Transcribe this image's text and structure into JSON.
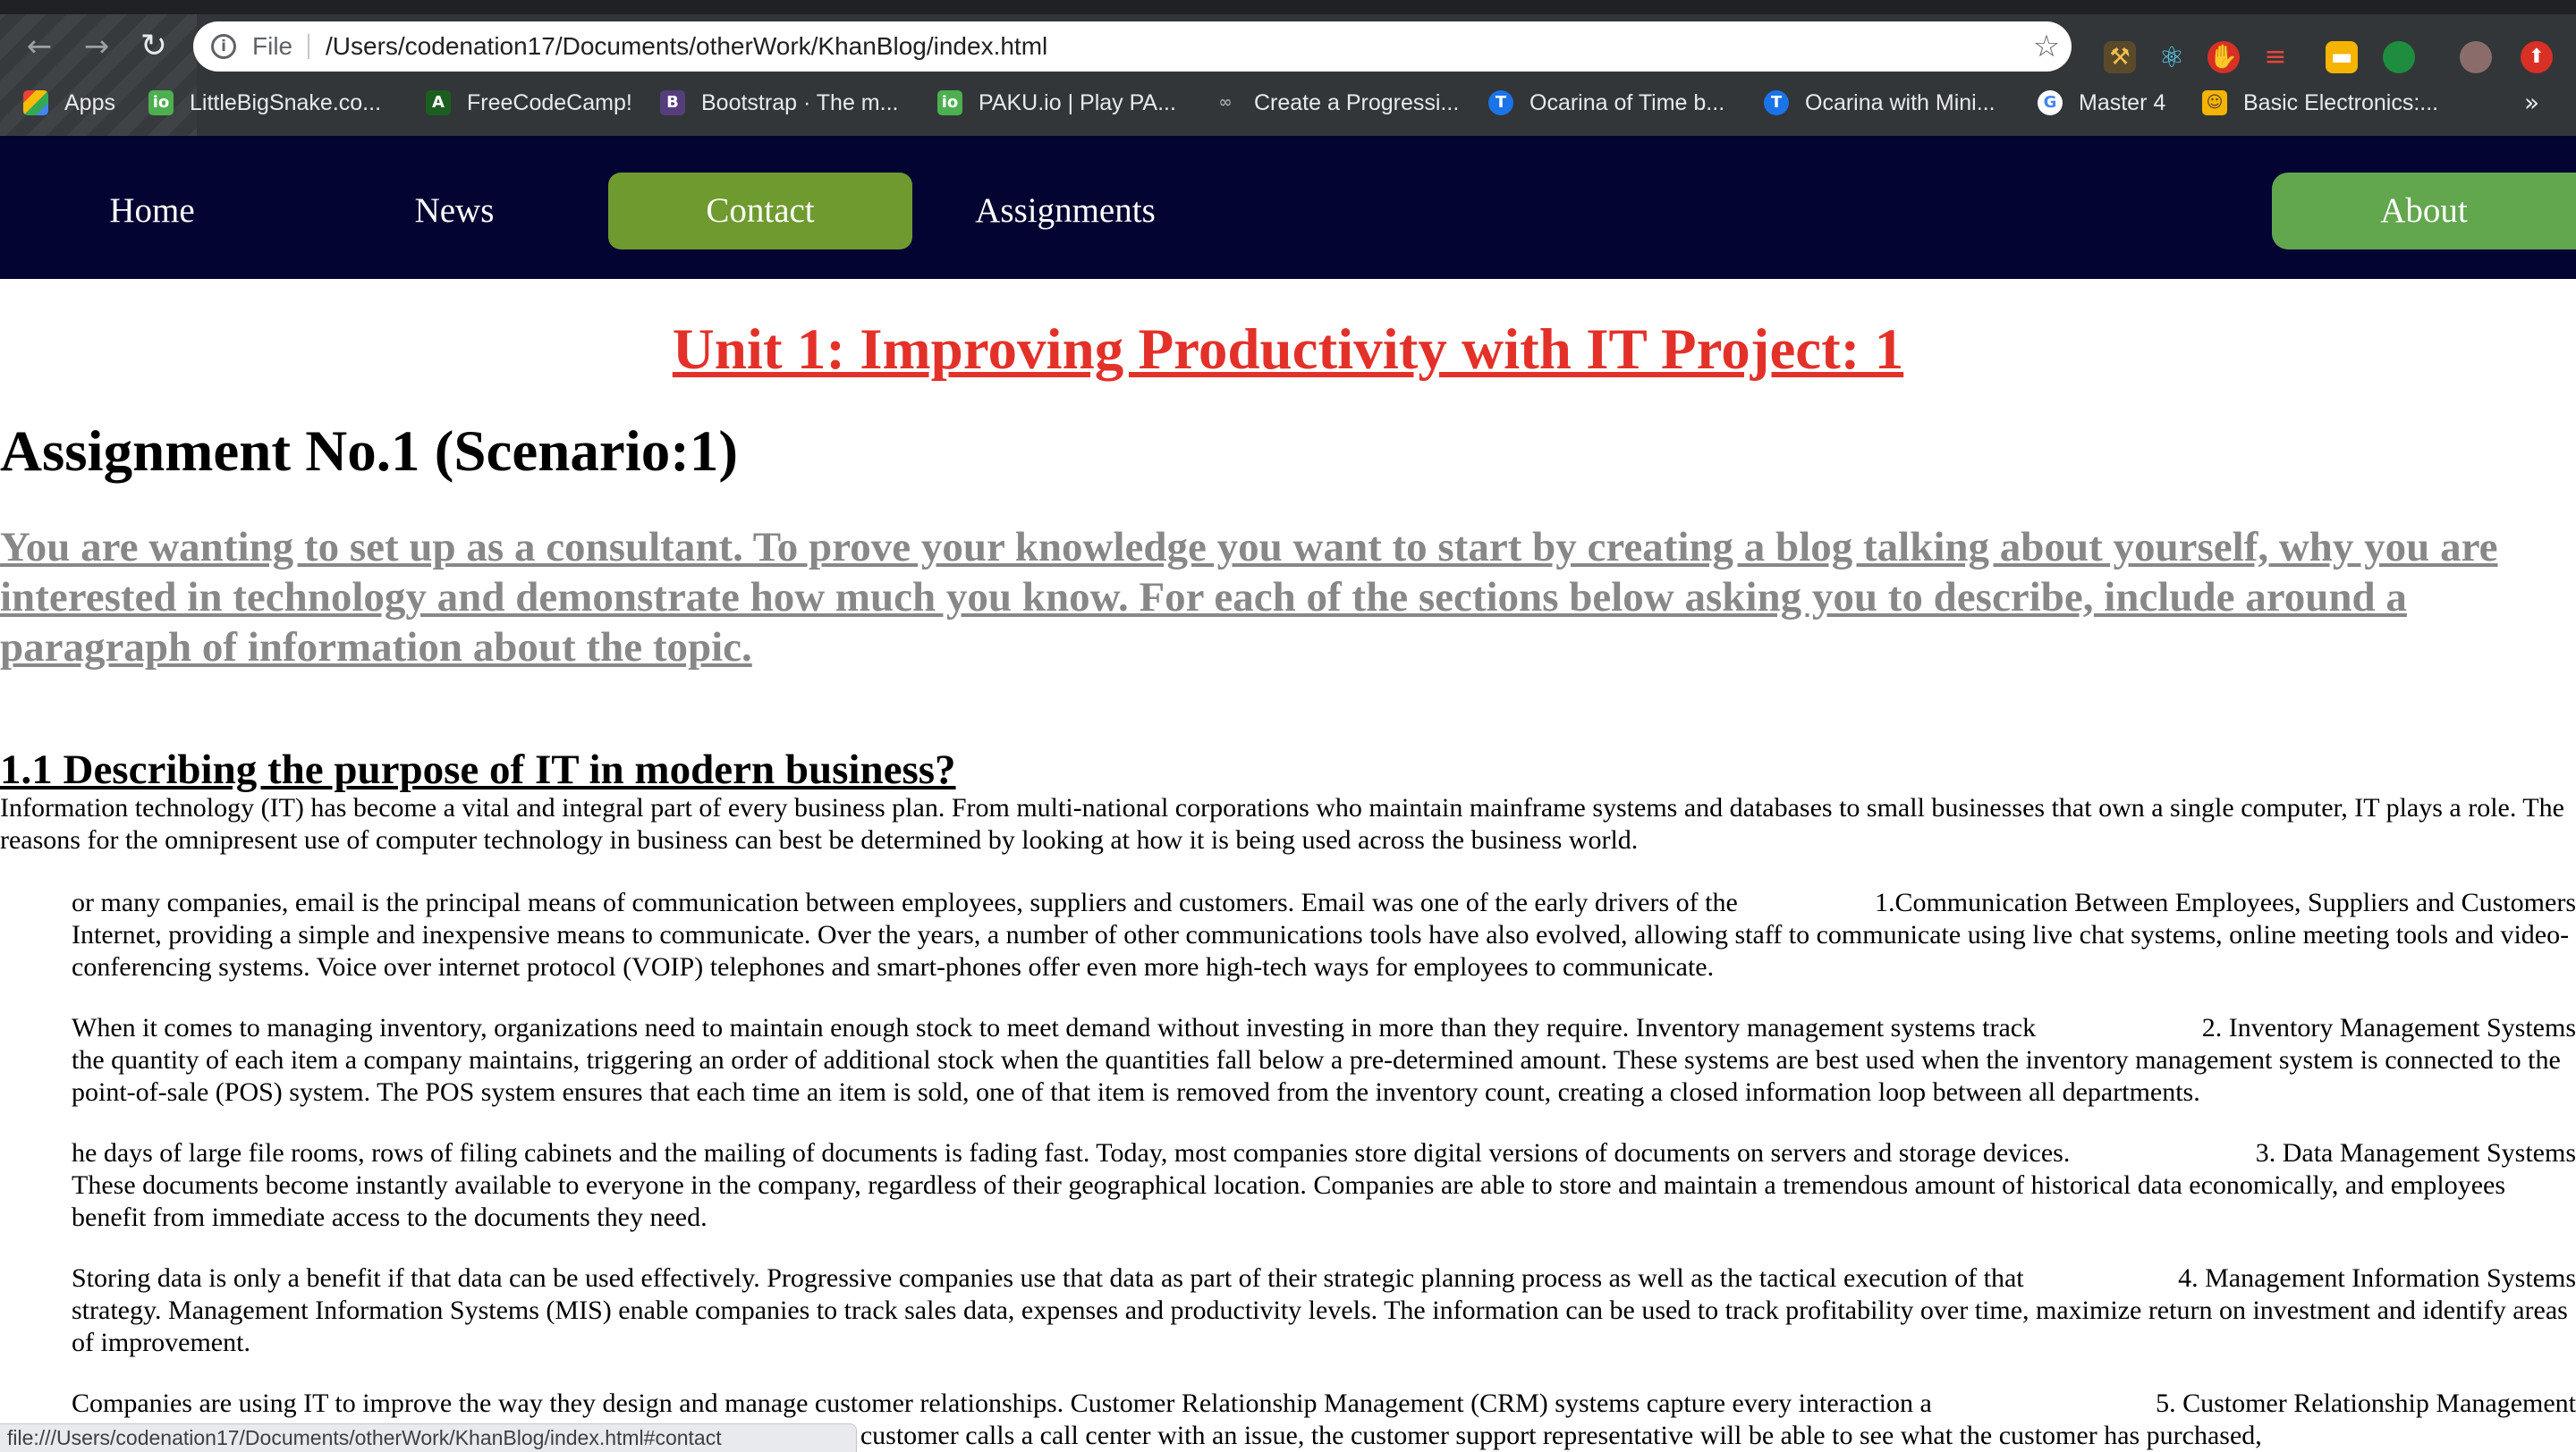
{
  "browser": {
    "scheme_label": "File",
    "url": "/Users/codenation17/Documents/otherWork/KhanBlog/index.html",
    "bookmarks": [
      {
        "label": "Apps",
        "icon": "apps-grid-icon"
      },
      {
        "label": "LittleBigSnake.co...",
        "icon": "littlebigsnake-icon"
      },
      {
        "label": "FreeCodeCamp!",
        "icon": "freecodecamp-icon"
      },
      {
        "label": "Bootstrap · The m...",
        "icon": "bootstrap-icon"
      },
      {
        "label": "PAKU.io | Play PA...",
        "icon": "paku-icon"
      },
      {
        "label": "Create a Progressi...",
        "icon": "progressive-icon"
      },
      {
        "label": "Ocarina of Time b...",
        "icon": "ocarina-icon"
      },
      {
        "label": "Ocarina with Mini...",
        "icon": "ocarina-icon"
      },
      {
        "label": "Master 4",
        "icon": "google-icon"
      },
      {
        "label": "Basic Electronics:...",
        "icon": "electronics-icon"
      }
    ],
    "bookmarks_more": "»",
    "status_text": "file:///Users/codenation17/Documents/otherWork/KhanBlog/index.html#contact"
  },
  "nav": {
    "home": "Home",
    "news": "News",
    "contact": "Contact",
    "assignments": "Assignments",
    "about": "About"
  },
  "page": {
    "unit_title": "Unit 1: Improving Productivity with IT Project: 1",
    "assignment_title": "Assignment No.1 (Scenario:1)",
    "scenario_text": "You are wanting to set up as a consultant. To prove your knowledge you want to start by creating a blog talking about yourself, why you are interested in technology and demonstrate how much you know. For each of the sections below asking you to describe, include around a paragraph of information about the topic.",
    "section_heading": "1.1 Describing the purpose of IT in modern business?",
    "intro": "Information technology (IT) has become a vital and integral part of every business plan. From multi-national corporations who maintain mainframe systems and databases to small businesses that own a single computer, IT plays a role. The reasons for the omnipresent use of computer technology in business can best be determined by looking at how it is being used across the business world.",
    "blocks": [
      {
        "label": "1.Communication Between Employees, Suppliers and Customers",
        "lead": "or many companies, email is the principal means of communication between employees, suppliers and customers. Email was one of the early drivers of the",
        "rest": "Internet, providing a simple and inexpensive means to communicate. Over the years, a number of other communications tools have also evolved, allowing staff to communicate using live chat systems, online meeting tools and video-conferencing systems. Voice over internet protocol (VOIP) telephones and smart-phones offer even more high-tech ways for employees to communicate."
      },
      {
        "label": "2. Inventory Management Systems",
        "lead": "When it comes to managing inventory, organizations need to maintain enough stock to meet demand without investing in more than they require. Inventory management systems track",
        "rest": "the quantity of each item a company maintains, triggering an order of additional stock when the quantities fall below a pre-determined amount. These systems are best used when the inventory management system is connected to the point-of-sale (POS) system. The POS system ensures that each time an item is sold, one of that item is removed from the inventory count, creating a closed information loop between all departments."
      },
      {
        "label": "3. Data Management Systems",
        "lead": "he days of large file rooms, rows of filing cabinets and the mailing of documents is fading fast. Today, most companies store digital versions of documents on servers and storage devices.",
        "rest": "These documents become instantly available to everyone in the company, regardless of their geographical location. Companies are able to store and maintain a tremendous amount of historical data economically, and employees benefit from immediate access to the documents they need."
      },
      {
        "label": "4. Management Information Systems",
        "lead": "Storing data is only a benefit if that data can be used effectively. Progressive companies use that data as part of their strategic planning process as well as the tactical execution of that",
        "rest": "strategy. Management Information Systems (MIS) enable companies to track sales data, expenses and productivity levels. The information can be used to track profitability over time, maximize return on investment and identify areas of improvement."
      },
      {
        "label": "5. Customer Relationship Management",
        "lead": "Companies are using IT to improve the way they design and manage customer relationships. Customer Relationship Management (CRM) systems capture every interaction a",
        "rest": "company has with a customer, so that a richer experience is possible. If a customer calls a call center with an issue, the customer support representative will be able to see what the customer has purchased,"
      }
    ]
  },
  "colors": {
    "nav_bg": "#040432",
    "contact_bg": "#6e9a2f",
    "about_bg": "#62a64e",
    "unit_title": "#e3312a",
    "scenario_text": "#888888"
  }
}
